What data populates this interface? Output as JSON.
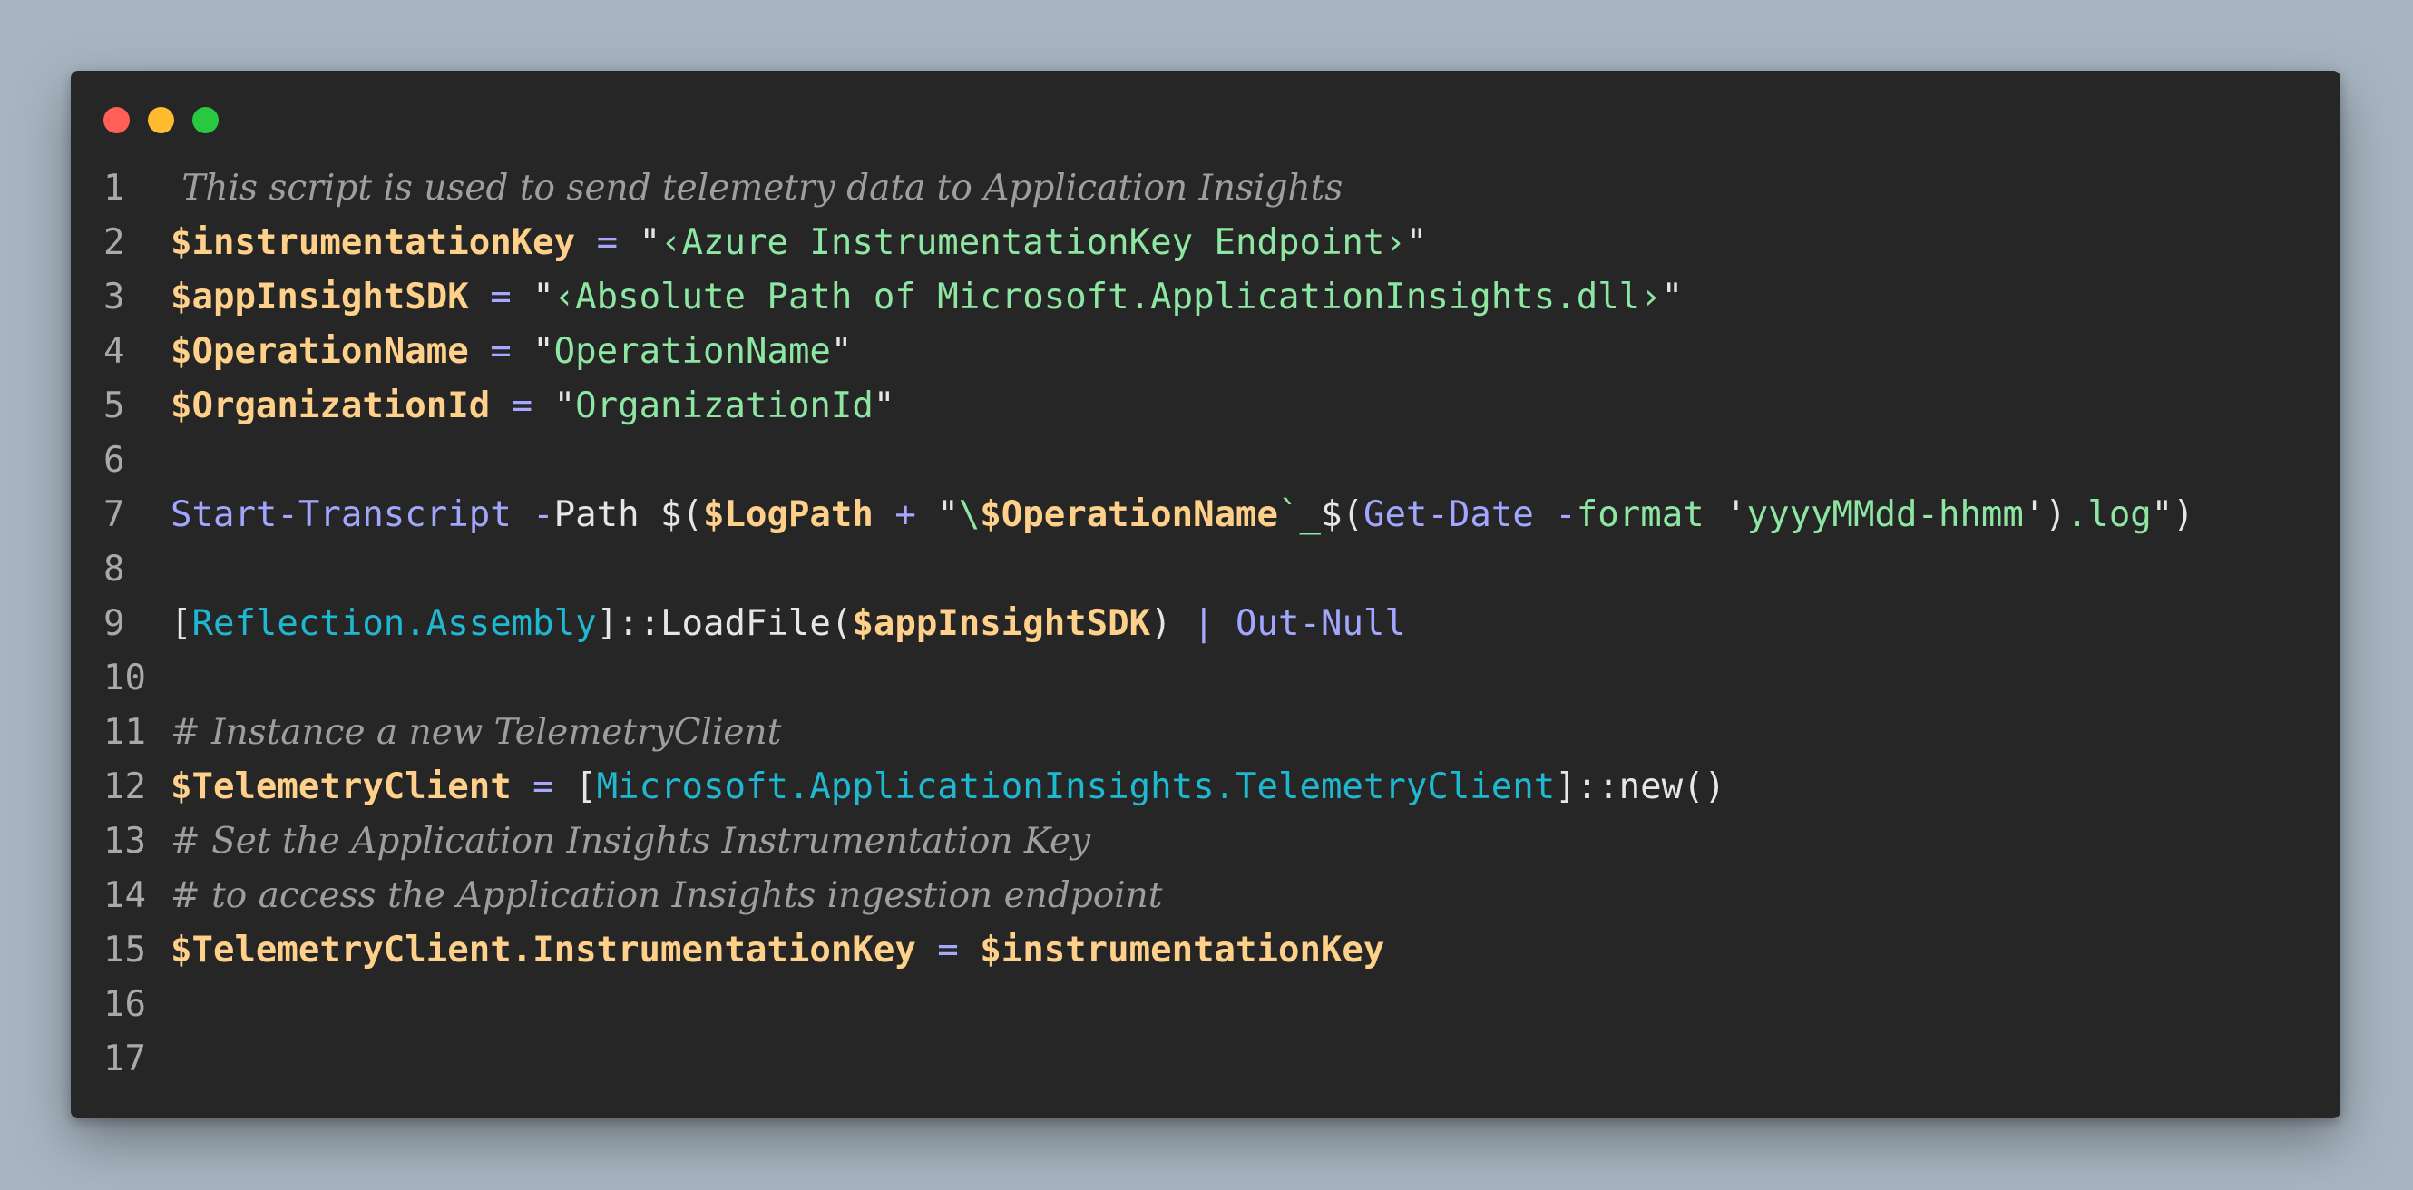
{
  "window": {
    "controls": [
      "close",
      "minimize",
      "zoom"
    ],
    "colors": {
      "close": "#ff5f57",
      "minimize": "#febc2e",
      "zoom": "#28c840",
      "background": "#262626"
    }
  },
  "code": {
    "line_numbers": [
      "1",
      "2",
      "3",
      "4",
      "5",
      "6",
      "7",
      "8",
      "9",
      "10",
      "11",
      "12",
      "13",
      "14",
      "15",
      "16",
      "17"
    ],
    "lines": [
      [
        {
          "t": "cm",
          "v": " This script is used to send telemetry data to Application Insights"
        }
      ],
      [
        {
          "t": "var",
          "v": "$instrumentationKey"
        },
        {
          "t": "op",
          "v": " = "
        },
        {
          "t": "pl",
          "v": "\""
        },
        {
          "t": "str",
          "v": "‹Azure InstrumentationKey Endpoint›"
        },
        {
          "t": "pl",
          "v": "\""
        }
      ],
      [
        {
          "t": "var",
          "v": "$appInsightSDK"
        },
        {
          "t": "op",
          "v": " = "
        },
        {
          "t": "pl",
          "v": "\""
        },
        {
          "t": "str",
          "v": "‹Absolute Path of Microsoft.ApplicationInsights.dll›"
        },
        {
          "t": "pl",
          "v": "\""
        }
      ],
      [
        {
          "t": "var",
          "v": "$OperationName"
        },
        {
          "t": "op",
          "v": " = "
        },
        {
          "t": "pl",
          "v": "\""
        },
        {
          "t": "str",
          "v": "OperationName"
        },
        {
          "t": "pl",
          "v": "\""
        }
      ],
      [
        {
          "t": "var",
          "v": "$OrganizationId"
        },
        {
          "t": "op",
          "v": " = "
        },
        {
          "t": "pl",
          "v": "\""
        },
        {
          "t": "str",
          "v": "OrganizationId"
        },
        {
          "t": "pl",
          "v": "\""
        }
      ],
      [],
      [
        {
          "t": "cmd",
          "v": "Start-Transcript"
        },
        {
          "t": "op",
          "v": " -"
        },
        {
          "t": "pl",
          "v": "Path $("
        },
        {
          "t": "var",
          "v": "$LogPath"
        },
        {
          "t": "op",
          "v": " + "
        },
        {
          "t": "pl",
          "v": "\""
        },
        {
          "t": "str",
          "v": "\\"
        },
        {
          "t": "var",
          "v": "$OperationName"
        },
        {
          "t": "str",
          "v": "`_"
        },
        {
          "t": "pl",
          "v": "$("
        },
        {
          "t": "cmd",
          "v": "Get-Date"
        },
        {
          "t": "op",
          "v": " -"
        },
        {
          "t": "str",
          "v": "format"
        },
        {
          "t": "pl",
          "v": " '"
        },
        {
          "t": "str",
          "v": "yyyyMMdd-hhmm"
        },
        {
          "t": "pl",
          "v": "')"
        },
        {
          "t": "str",
          "v": ".log"
        },
        {
          "t": "pl",
          "v": "\")"
        }
      ],
      [],
      [
        {
          "t": "pl",
          "v": "["
        },
        {
          "t": "type",
          "v": "Reflection.Assembly"
        },
        {
          "t": "pl",
          "v": "]::LoadFile("
        },
        {
          "t": "var",
          "v": "$appInsightSDK"
        },
        {
          "t": "pl",
          "v": ")"
        },
        {
          "t": "op",
          "v": " | "
        },
        {
          "t": "cmd",
          "v": "Out-Null"
        }
      ],
      [],
      [
        {
          "t": "cm",
          "v": "# Instance a new TelemetryClient"
        }
      ],
      [
        {
          "t": "var",
          "v": "$TelemetryClient"
        },
        {
          "t": "op",
          "v": " = "
        },
        {
          "t": "pl",
          "v": "["
        },
        {
          "t": "type",
          "v": "Microsoft.ApplicationInsights.TelemetryClient"
        },
        {
          "t": "pl",
          "v": "]::new()"
        }
      ],
      [
        {
          "t": "cm",
          "v": "# Set the Application Insights Instrumentation Key"
        }
      ],
      [
        {
          "t": "cm",
          "v": "# to access the Application Insights ingestion endpoint"
        }
      ],
      [
        {
          "t": "var",
          "v": "$TelemetryClient.InstrumentationKey"
        },
        {
          "t": "op",
          "v": " = "
        },
        {
          "t": "var",
          "v": "$instrumentationKey"
        }
      ],
      [],
      []
    ]
  }
}
